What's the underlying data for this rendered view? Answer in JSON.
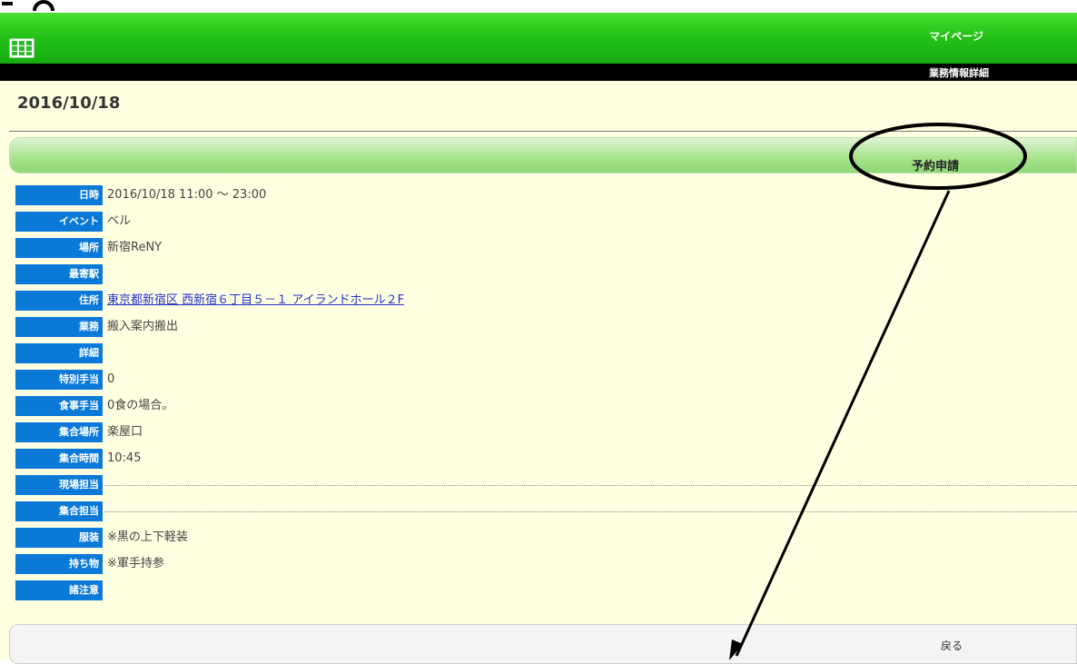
{
  "header": {
    "mypage_label": "マイページ",
    "page_subtitle": "業務情報詳細"
  },
  "date_heading": "2016/10/18",
  "reserve_button_label": "予約申請",
  "details": [
    {
      "label": "日時",
      "value": "2016/10/18 11:00 ～ 23:00"
    },
    {
      "label": "イベント",
      "value": "ベル"
    },
    {
      "label": "場所",
      "value": "新宿ReNY"
    },
    {
      "label": "最寄駅",
      "value": ""
    },
    {
      "label": "住所",
      "value": "東京都新宿区 西新宿６丁目５－１ アイランドホール２F"
    },
    {
      "label": "業務",
      "value": "搬入案内搬出"
    },
    {
      "label": "詳細",
      "value": ""
    },
    {
      "label": "特別手当",
      "value": "0"
    },
    {
      "label": "食事手当",
      "value": "0食の場合。"
    },
    {
      "label": "集合場所",
      "value": "楽屋口"
    },
    {
      "label": "集合時間",
      "value": "10:45"
    },
    {
      "label": "現場担当",
      "value": ""
    },
    {
      "label": "集合担当",
      "value": ""
    },
    {
      "label": "服装",
      "value": "※黒の上下軽装"
    },
    {
      "label": "持ち物",
      "value": "※軍手持参"
    },
    {
      "label": "諸注意",
      "value": ""
    }
  ],
  "back_button_label": "戻る",
  "icons": {
    "menu_grid": "grid-icon"
  }
}
